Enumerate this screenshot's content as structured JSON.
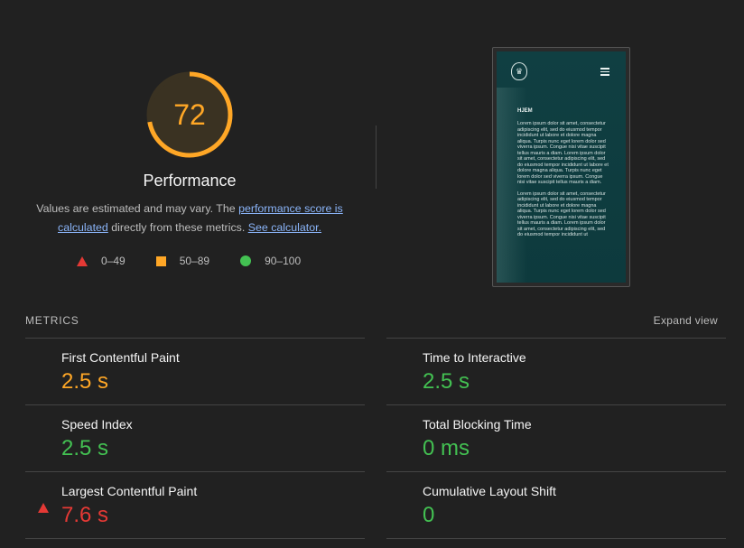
{
  "score": {
    "value": "72",
    "fraction": 0.72,
    "color": "#ffa726",
    "title": "Performance"
  },
  "description": {
    "prefix": "Values are estimated and may vary. The ",
    "link1": "performance score is calculated",
    "middle": " directly from these metrics. ",
    "link2": "See calculator."
  },
  "legend": [
    {
      "shape": "triangle",
      "label": "0–49",
      "color": "#e53935"
    },
    {
      "shape": "square",
      "label": "50–89",
      "color": "#ffa726"
    },
    {
      "shape": "circle",
      "label": "90–100",
      "color": "#43c152"
    }
  ],
  "screenshot": {
    "heading": "HJEM",
    "paragraphs": [
      "Lorem ipsum dolor sit amet, consectetur adipiscing elit, sed do eiusmod tempor incididunt ut labore et dolore magna aliqua. Turpis nunc eget lorem dolor sed viverra ipsum. Congue nisi vitae suscipit tellus mauris a diam. Lorem ipsum dolor sit amet, consectetur adipiscing elit, sed do eiusmod tempor incididunt ut labore et dolore magna aliqua. Turpis nunc eget lorem dolor sed viverra ipsum. Congue nisi vitae suscipit tellus mauris a diam.",
      "Lorem ipsum dolor sit amet, consectetur adipiscing elit, sed do eiusmod tempor incididunt ut labore et dolore magna aliqua. Turpis nunc eget lorem dolor sed viverra ipsum. Congue nisi vitae suscipit tellus mauris a diam. Lorem ipsum dolor sit amet, consectetur adipiscing elit, sed do eiusmod tempor incididunt ut"
    ]
  },
  "metrics": {
    "label": "METRICS",
    "expand": "Expand view",
    "left": [
      {
        "name": "First Contentful Paint",
        "value": "2.5 s",
        "rating": "average"
      },
      {
        "name": "Speed Index",
        "value": "2.5 s",
        "rating": "pass"
      },
      {
        "name": "Largest Contentful Paint",
        "value": "7.6 s",
        "rating": "fail"
      }
    ],
    "right": [
      {
        "name": "Time to Interactive",
        "value": "2.5 s",
        "rating": "pass"
      },
      {
        "name": "Total Blocking Time",
        "value": "0 ms",
        "rating": "pass"
      },
      {
        "name": "Cumulative Layout Shift",
        "value": "0",
        "rating": "pass"
      }
    ]
  },
  "colors": {
    "pass": "#43c152",
    "average": "#ffa726",
    "fail": "#e53935"
  }
}
